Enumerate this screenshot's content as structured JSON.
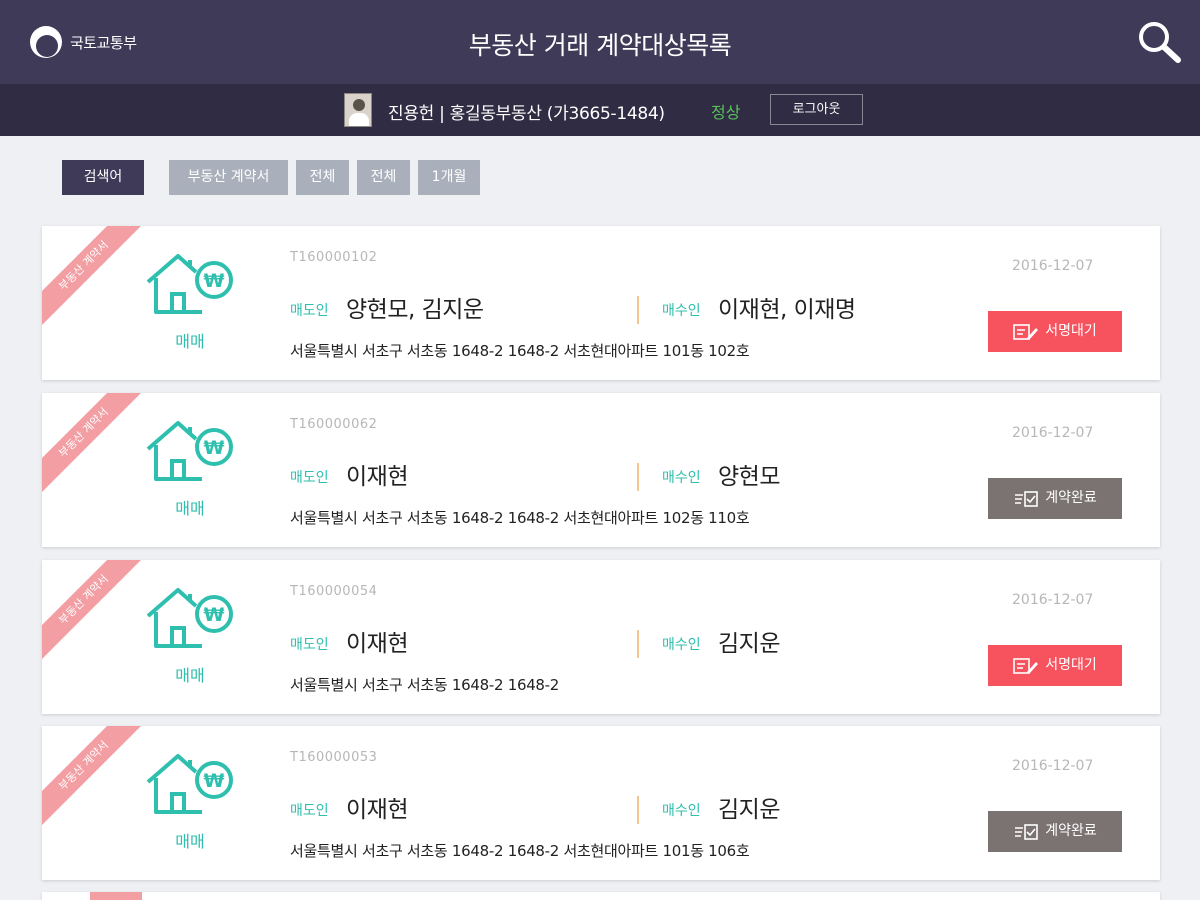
{
  "header": {
    "logo_text": "국토교통부",
    "title": "부동산 거래 계약대상목록",
    "search_icon": "search-icon"
  },
  "userbar": {
    "user_info": "진용헌 | 홍길동부동산 (가3665-1484)",
    "status": "정상",
    "logout_label": "로그아웃"
  },
  "filters": {
    "search_label": "검색어",
    "chips": [
      "부동산 계약서",
      "전체",
      "전체",
      "1개월"
    ]
  },
  "contracts": [
    {
      "ribbon": "부동산 계약서",
      "type": "매매",
      "id": "T160000102",
      "seller_label": "매도인",
      "seller": "양현모, 김지운",
      "buyer_label": "매수인",
      "buyer": "이재현, 이재명",
      "address": "서울특별시 서초구 서초동 1648-2 1648-2 서초현대아파트 101동 102호",
      "date": "2016-12-07",
      "status": "서명대기",
      "status_color": "#f7535f"
    },
    {
      "ribbon": "부동산 계약서",
      "type": "매매",
      "id": "T160000062",
      "seller_label": "매도인",
      "seller": "이재현",
      "buyer_label": "매수인",
      "buyer": "양현모",
      "address": "서울특별시 서초구 서초동 1648-2 1648-2 서초현대아파트 102동 110호",
      "date": "2016-12-07",
      "status": "계약완료",
      "status_color": "#7a7371"
    },
    {
      "ribbon": "부동산 계약서",
      "type": "매매",
      "id": "T160000054",
      "seller_label": "매도인",
      "seller": "이재현",
      "buyer_label": "매수인",
      "buyer": "김지운",
      "address": "서울특별시 서초구 서초동 1648-2 1648-2",
      "date": "2016-12-07",
      "status": "서명대기",
      "status_color": "#f7535f"
    },
    {
      "ribbon": "부동산 계약서",
      "type": "매매",
      "id": "T160000053",
      "seller_label": "매도인",
      "seller": "이재현",
      "buyer_label": "매수인",
      "buyer": "김지운",
      "address": "서울특별시 서초구 서초동 1648-2 1648-2 서초현대아파트 101동 106호",
      "date": "2016-12-07",
      "status": "계약완료",
      "status_color": "#7a7371"
    }
  ],
  "colors": {
    "header_bg": "#3e3a58",
    "userbar_bg": "#2f2c43",
    "accent_teal": "#2ebfae",
    "status_ok": "#59c159",
    "pending_red": "#f7535f",
    "done_gray": "#7a7371",
    "ribbon_pink": "#f29ea3"
  }
}
